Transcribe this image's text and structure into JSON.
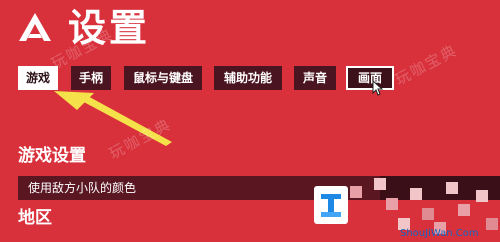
{
  "header": {
    "title": "设置",
    "logo_icon": "triangle-logo-icon"
  },
  "tabs": [
    {
      "label": "游戏",
      "state": "active"
    },
    {
      "label": "手柄",
      "state": "normal"
    },
    {
      "label": "鼠标与键盘",
      "state": "normal"
    },
    {
      "label": "辅助功能",
      "state": "normal"
    },
    {
      "label": "声音",
      "state": "normal"
    },
    {
      "label": "画面",
      "state": "hovered"
    }
  ],
  "game_settings": {
    "heading": "游戏设置",
    "rows": [
      {
        "label": "使用敌方小队的颜色"
      }
    ]
  },
  "region": {
    "heading": "地区"
  },
  "watermark": {
    "text_1": "玩咖宝典",
    "text_2": "玩咖宝典",
    "text_3": "玩咖宝典",
    "site": "ShouJiWan.Com"
  },
  "colors": {
    "background": "#d9313c",
    "tab_bg": "#4a1420",
    "tab_active_bg": "#ffffff",
    "row_bg": "#5a1722",
    "arrow": "#f5e14a"
  }
}
